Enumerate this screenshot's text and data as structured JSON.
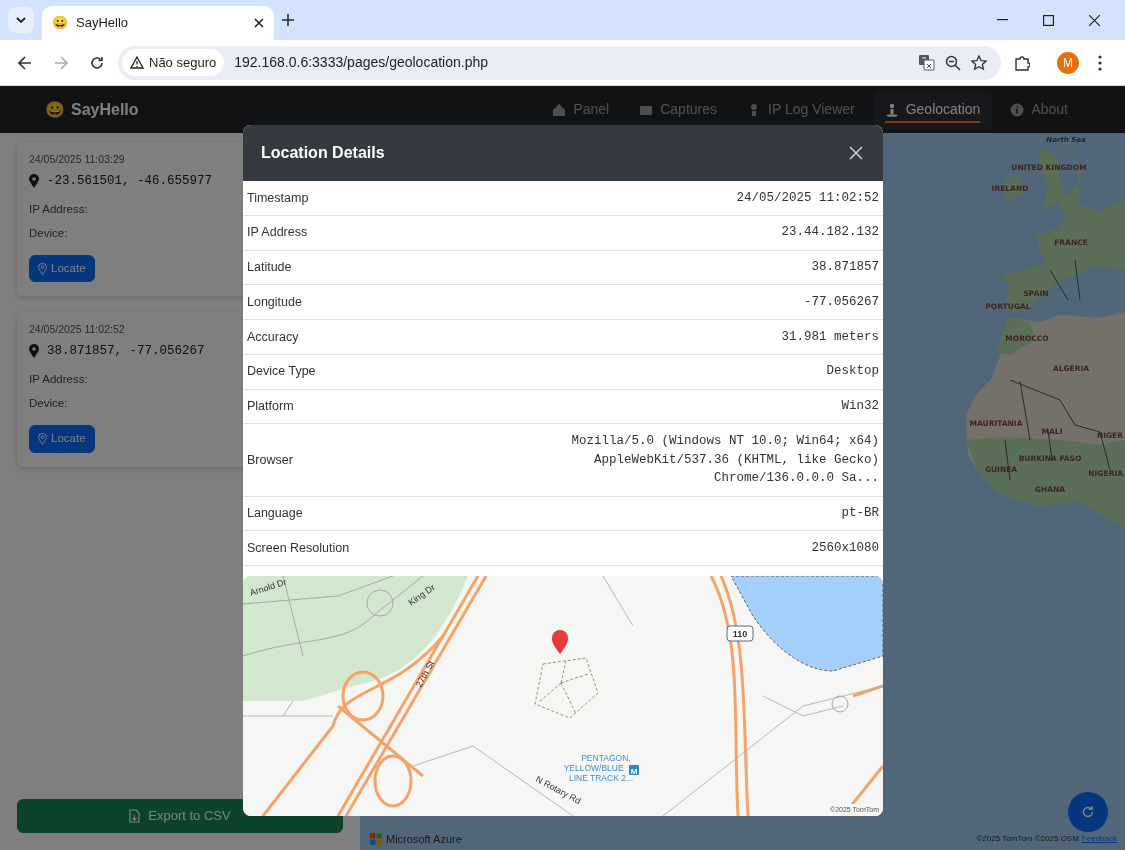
{
  "browser": {
    "tab_title": "SayHello",
    "tab_favicon": "😀",
    "security_label": "Não seguro",
    "url": "192.168.0.6:3333/pages/geolocation.php",
    "avatar": "M"
  },
  "navbar": {
    "brand_icon": "😀",
    "brand": "SayHello",
    "items": [
      {
        "label": "Panel",
        "selected": false
      },
      {
        "label": "Captures",
        "selected": false
      },
      {
        "label": "IP Log Viewer",
        "selected": false
      },
      {
        "label": "Geolocation",
        "selected": true
      },
      {
        "label": "About",
        "selected": false
      }
    ]
  },
  "history": [
    {
      "timestamp": "24/05/2025 11:03:29",
      "coords": "-23.561501, -46.655977",
      "ip_label": "IP Address:",
      "device_label": "Device:",
      "button": "Locate"
    },
    {
      "timestamp": "24/05/2025 11:02:52",
      "coords": "38.871857, -77.056267",
      "ip_label": "IP Address:",
      "device_label": "Device:",
      "button": "Locate"
    }
  ],
  "export_button": "Export to CSV",
  "world_map": {
    "labels": [
      "North Sea",
      "UNITED KINGDOM",
      "IRELAND",
      "FRANCE",
      "SPAIN",
      "PORTUGAL",
      "MOROCCO",
      "ALGERIA",
      "MAURITANIA",
      "MALI",
      "NIGER",
      "BURKINA FASO",
      "GUINEA",
      "NIGERIA",
      "GHANA"
    ],
    "brand": "Microsoft Azure",
    "attribution": "©2025 TomTom ©2025 OSM",
    "feedback": "Feedback"
  },
  "modal": {
    "title": "Location Details",
    "details": [
      {
        "label": "Timestamp",
        "value": "24/05/2025 11:02:52"
      },
      {
        "label": "IP Address",
        "value": "23.44.182.132"
      },
      {
        "label": "Latitude",
        "value": "38.871857"
      },
      {
        "label": "Longitude",
        "value": "-77.056267"
      },
      {
        "label": "Accuracy",
        "value": "31.981 meters"
      },
      {
        "label": "Device Type",
        "value": "Desktop"
      },
      {
        "label": "Platform",
        "value": "Win32"
      },
      {
        "label": "Browser",
        "value": "Mozilla/5.0 (Windows NT 10.0; Win64; x64) AppleWebKit/537.36 (KHTML, like Gecko) Chrome/136.0.0.0 Sa..."
      },
      {
        "label": "Language",
        "value": "pt-BR"
      },
      {
        "label": "Screen Resolution",
        "value": "2560x1080"
      }
    ],
    "map": {
      "street_labels": [
        "Arnold Dr",
        "King Dr",
        "27th St",
        "N Rotary Rd"
      ],
      "route_shield": "110",
      "station": "PENTAGON, YELLOW/BLUE LINE TRACK 2...",
      "metro_sign": "M",
      "attribution": "©2025 TomTom"
    }
  }
}
